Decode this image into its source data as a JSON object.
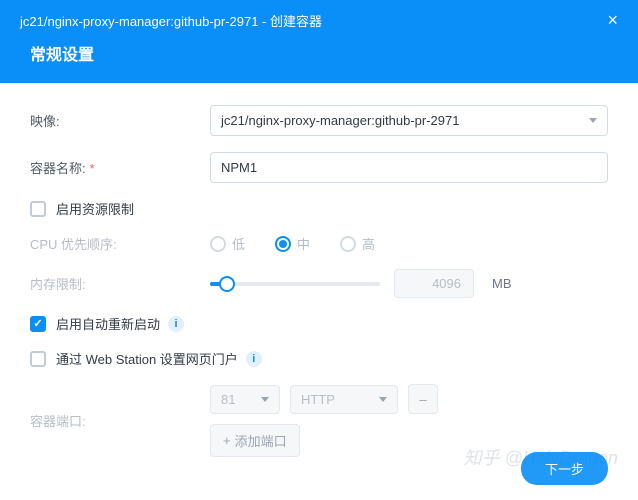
{
  "header": {
    "title": "jc21/nginx-proxy-manager:github-pr-2971 - 创建容器"
  },
  "section_title": "常规设置",
  "labels": {
    "image": "映像:",
    "container_name": "容器名称:",
    "resource_limit": "启用资源限制",
    "cpu_priority": "CPU 优先顺序:",
    "mem_limit": "内存限制:",
    "auto_restart": "启用自动重新启动",
    "web_station": "通过 Web Station 设置网页门户",
    "container_port": "容器端口:"
  },
  "values": {
    "image": "jc21/nginx-proxy-manager:github-pr-2971",
    "container_name": "NPM1",
    "cpu_options": {
      "low": "低",
      "mid": "中",
      "high": "高"
    },
    "cpu_selected": "mid",
    "mem_value": "4096",
    "mem_unit": "MB",
    "port": "81",
    "protocol": "HTTP",
    "add_port": "添加端口"
  },
  "buttons": {
    "next": "下一步"
  },
  "watermark": "知乎 @HolyDragon"
}
